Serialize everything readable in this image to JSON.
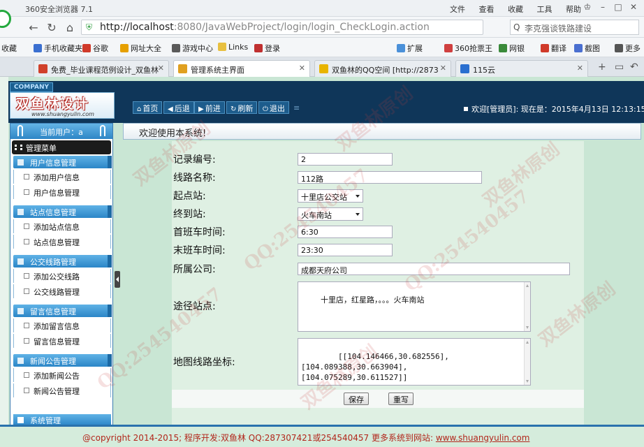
{
  "browser": {
    "app_title": "360安全浏览器 7.1",
    "menus": [
      "文件",
      "查看",
      "收藏",
      "工具",
      "帮助"
    ],
    "url_host": "http://localhost",
    "url_rest": ":8080/JavaWebProject/login/login_CheckLogin.action",
    "search_text": "李克强谈铁路建设",
    "favorites": [
      {
        "label": "收藏",
        "icon": "star-icon",
        "color": "#f0b400"
      },
      {
        "label": "手机收藏夹",
        "icon": "phone-icon",
        "color": "#3a6fd0"
      },
      {
        "label": "谷歌",
        "icon": "google-icon",
        "color": "#d03a2a"
      },
      {
        "label": "网址大全",
        "icon": "globe-icon",
        "color": "#e6a000"
      },
      {
        "label": "游戏中心",
        "icon": "gamepad-icon",
        "color": "#5a5a5a"
      },
      {
        "label": "Links",
        "icon": "folder-icon",
        "color": "#e8c040"
      },
      {
        "label": "登录",
        "icon": "login-icon",
        "color": "#c03030"
      },
      {
        "label": "扩展",
        "icon": "extension-icon",
        "color": "#4a90d9"
      },
      {
        "label": "360抢票王",
        "icon": "ticket-icon",
        "color": "#d04040"
      },
      {
        "label": "网银",
        "icon": "bank-icon",
        "color": "#3a8a3a"
      },
      {
        "label": "翻译",
        "icon": "translate-icon",
        "color": "#d03a2a"
      },
      {
        "label": "截图",
        "icon": "scissors-icon",
        "color": "#4a6fd0"
      },
      {
        "label": "更多",
        "icon": "more-icon",
        "color": "#555555"
      }
    ],
    "tabs": [
      {
        "label": "免费_毕业课程范例设计_双鱼林",
        "color": "#d0402a"
      },
      {
        "label": "管理系统主界面",
        "color": "#e0a020"
      },
      {
        "label": "双鱼林的QQ空间 [http://2873",
        "color": "#e8b400"
      },
      {
        "label": "115云",
        "color": "#2a6fd0"
      }
    ]
  },
  "header": {
    "company": "COMPANY",
    "brand": "双鱼林设计",
    "site": "www.shuangyulin.com",
    "nav": [
      "首页",
      "后退",
      "前进",
      "刷新",
      "退出"
    ],
    "welcome_user": "欢迎[管理员]:",
    "now_label": "现在是：2015年4月13日 12:13:15"
  },
  "sidebar": {
    "current_user_label": "当前用户：a",
    "main_menu": "管理菜单",
    "sections": [
      {
        "title": "用户信息管理",
        "items": [
          "添加用户信息",
          "用户信息管理"
        ]
      },
      {
        "title": "站点信息管理",
        "items": [
          "添加站点信息",
          "站点信息管理"
        ]
      },
      {
        "title": "公交线路管理",
        "items": [
          "添加公交线路",
          "公交线路管理"
        ]
      },
      {
        "title": "留言信息管理",
        "items": [
          "添加留言信息",
          "留言信息管理"
        ]
      },
      {
        "title": "新闻公告管理",
        "items": [
          "添加新闻公告",
          "新闻公告管理"
        ]
      }
    ],
    "last_section": "系统管理"
  },
  "content": {
    "welcome": "欢迎使用本系统!",
    "fields": {
      "record_no": {
        "label": "记录编号:",
        "value": "2"
      },
      "line_name": {
        "label": "线路名称:",
        "value": "112路"
      },
      "start_station": {
        "label": "起点站:",
        "value": "十里店公交站"
      },
      "end_station": {
        "label": "终到站:",
        "value": "火车南站"
      },
      "first_bus": {
        "label": "首班车时间:",
        "value": "6:30"
      },
      "last_bus": {
        "label": "末班车时间:",
        "value": "23:30"
      },
      "company": {
        "label": "所属公司:",
        "value": "成都天府公司"
      },
      "via_stations": {
        "label": "途径站点:",
        "value": "十里店，红星路，。。。火车南站"
      },
      "map_coords": {
        "label": "地图线路坐标:",
        "value": "[[104.146466,30.682556],[104.089388,30.663904],\n[104.075289,30.611527]]"
      }
    },
    "save_label": "保存",
    "reset_label": "重写"
  },
  "footer": {
    "copyright": "@copyright 2014-2015; 程序开发:双鱼林  QQ:287307421或254540457  更多系统到网站:",
    "site_link": "www.shuangyulin.com"
  },
  "watermark": {
    "texts": [
      "双鱼林原创",
      "QQ:254540457",
      "双鱼林原创",
      "QQ:254540457",
      "双鱼林原创",
      "双鱼林原创",
      "QQ:254540457",
      "双鱼林原创"
    ]
  },
  "colors": {
    "header_bg": "#0f3659",
    "sidebar_section": "#2c86c7",
    "page_bg": "#c9e6d4",
    "footer_text": "#b2261b"
  }
}
